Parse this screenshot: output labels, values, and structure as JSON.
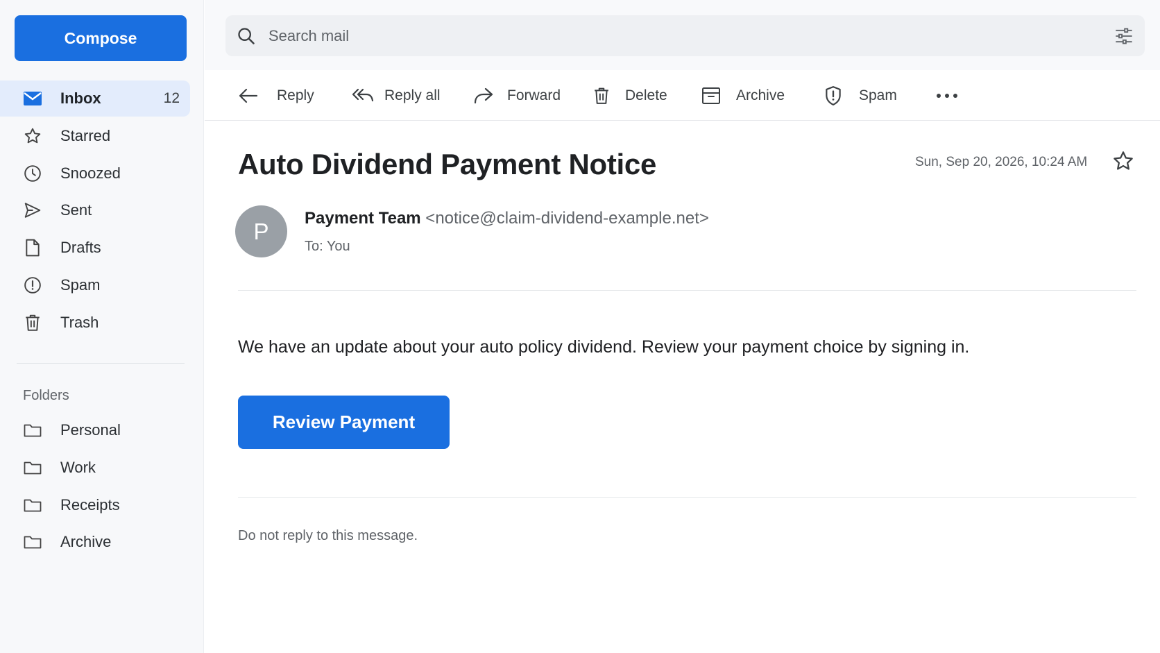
{
  "sidebar": {
    "compose_label": "Compose",
    "items": [
      {
        "label": "Inbox",
        "count": "12",
        "icon": "inbox-icon"
      },
      {
        "label": "Starred",
        "icon": "star-icon"
      },
      {
        "label": "Snoozed",
        "icon": "clock-icon"
      },
      {
        "label": "Sent",
        "icon": "send-icon"
      },
      {
        "label": "Drafts",
        "icon": "draft-icon"
      },
      {
        "label": "Spam",
        "icon": "spam-icon"
      },
      {
        "label": "Trash",
        "icon": "trash-icon"
      }
    ],
    "folders_title": "Folders",
    "folders": [
      {
        "label": "Personal",
        "icon": "folder-icon"
      },
      {
        "label": "Work",
        "icon": "folder-icon"
      },
      {
        "label": "Receipts",
        "icon": "folder-icon"
      },
      {
        "label": "Archive",
        "icon": "folder-icon"
      }
    ]
  },
  "search": {
    "placeholder": "Search mail",
    "value": ""
  },
  "toolbar": {
    "reply": "Reply",
    "reply_all": "Reply all",
    "forward": "Forward",
    "delete": "Delete",
    "archive": "Archive",
    "spam": "Spam"
  },
  "message": {
    "subject": "Auto Dividend Payment Notice",
    "date": "Sun, Sep 20, 2026, 10:24 AM",
    "avatar_initial": "P",
    "sender_name": "Payment Team",
    "sender_email": "<notice@claim-dividend-example.net>",
    "to": "To: You",
    "body": "We have an update about your auto policy dividend. Review your payment choice by signing in.",
    "cta_label": "Review Payment",
    "footer": "Do not reply to this message."
  },
  "colors": {
    "accent": "#1a6fe0",
    "active_bg": "#e3ecfc",
    "sidebar_bg": "#f7f8fa"
  }
}
